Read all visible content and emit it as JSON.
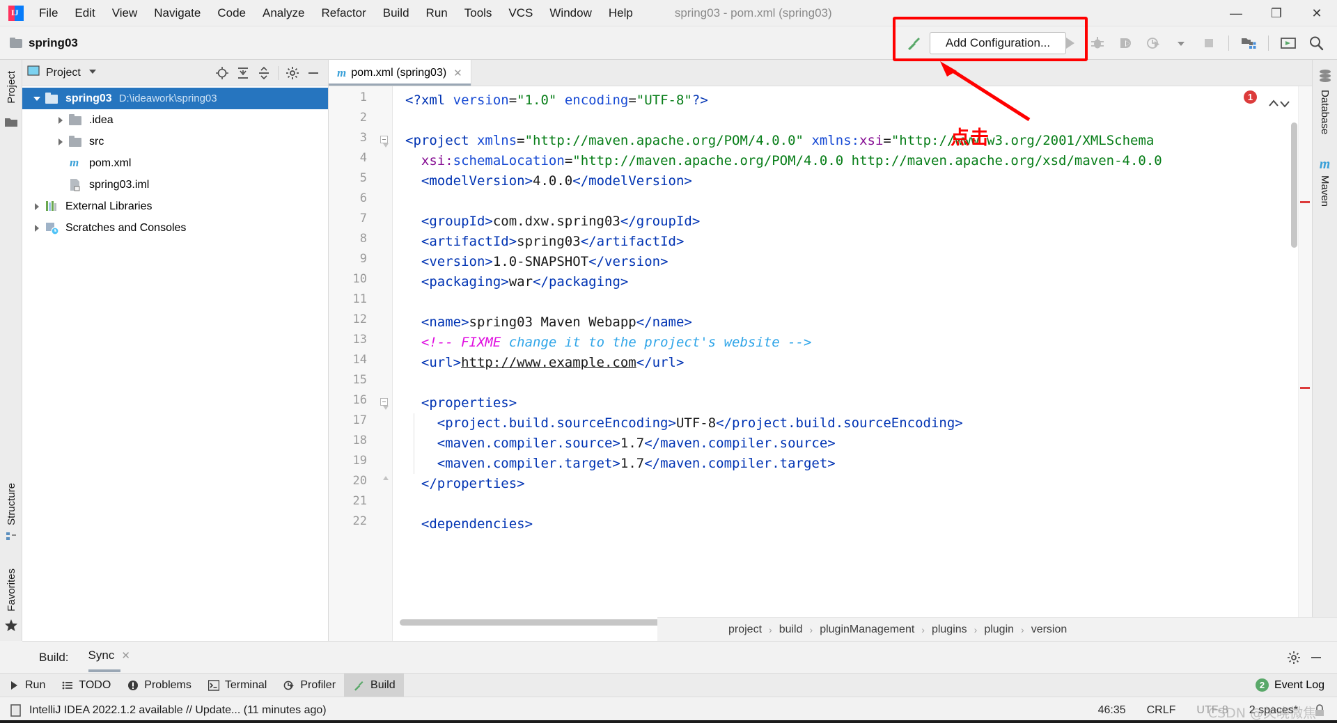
{
  "window": {
    "title": "spring03 - pom.xml (spring03)",
    "minimize": "—",
    "maximize": "❐",
    "close": "✕"
  },
  "menu": [
    {
      "label": "File"
    },
    {
      "label": "Edit"
    },
    {
      "label": "View"
    },
    {
      "label": "Navigate"
    },
    {
      "label": "Code"
    },
    {
      "label": "Analyze"
    },
    {
      "label": "Refactor"
    },
    {
      "label": "Build"
    },
    {
      "label": "Run"
    },
    {
      "label": "Tools"
    },
    {
      "label": "VCS"
    },
    {
      "label": "Window"
    },
    {
      "label": "Help"
    }
  ],
  "toolbar": {
    "project_chip": "spring03",
    "add_configuration": "Add Configuration...",
    "icons": [
      "hammer-icon",
      "run-icon",
      "debug-icon",
      "run-coverage-icon",
      "profile-icon",
      "dropdown-icon",
      "stop-icon",
      "project-structure-icon",
      "search-everywhere-icon",
      "magnifier-icon"
    ]
  },
  "annotation": {
    "text": "点击",
    "color": "#ff0000"
  },
  "left_strip": {
    "top": [
      "Project"
    ],
    "bottom": [
      "Structure",
      "Favorites"
    ]
  },
  "right_strip": [
    "Database",
    "Maven"
  ],
  "project_panel": {
    "header_title": "Project",
    "header_icons": [
      "locate-icon",
      "expand-all-icon",
      "collapse-all-icon",
      "settings-gear-icon",
      "hide-icon"
    ],
    "tree": [
      {
        "label": "spring03",
        "secondary": "D:\\ideawork\\spring03",
        "icon": "module-folder-icon",
        "indent": 0,
        "twisty": "down",
        "selected": true,
        "bold": true
      },
      {
        "label": ".idea",
        "secondary": "",
        "icon": "folder-icon",
        "indent": 1,
        "twisty": "right",
        "selected": false,
        "bold": false
      },
      {
        "label": "src",
        "secondary": "",
        "icon": "folder-icon",
        "indent": 1,
        "twisty": "right",
        "selected": false,
        "bold": false
      },
      {
        "label": "pom.xml",
        "secondary": "",
        "icon": "maven-file-icon",
        "indent": 1,
        "twisty": "none",
        "selected": false,
        "bold": false
      },
      {
        "label": "spring03.iml",
        "secondary": "",
        "icon": "iml-file-icon",
        "indent": 1,
        "twisty": "none",
        "selected": false,
        "bold": false
      },
      {
        "label": "External Libraries",
        "secondary": "",
        "icon": "libraries-icon",
        "indent": 0,
        "twisty": "right",
        "selected": false,
        "bold": false
      },
      {
        "label": "Scratches and Consoles",
        "secondary": "",
        "icon": "scratches-icon",
        "indent": 0,
        "twisty": "right",
        "selected": false,
        "bold": false
      }
    ]
  },
  "editor": {
    "tab": {
      "label": "pom.xml (spring03)",
      "icon": "maven-file-icon",
      "close": "✕"
    },
    "error_count": "1",
    "up_arrow": "∧",
    "down_arrow": "∨",
    "lines": [
      {
        "n": "1",
        "segments": [
          {
            "t": "<?xml ",
            "c": "k-tag"
          },
          {
            "t": "version",
            "c": "k-attr"
          },
          {
            "t": "=",
            "c": "k-txt"
          },
          {
            "t": "\"1.0\"",
            "c": "k-str"
          },
          {
            "t": " ",
            "c": "k-txt"
          },
          {
            "t": "encoding",
            "c": "k-attr"
          },
          {
            "t": "=",
            "c": "k-txt"
          },
          {
            "t": "\"UTF-8\"",
            "c": "k-str"
          },
          {
            "t": "?>",
            "c": "k-tag"
          }
        ],
        "indent": 0
      },
      {
        "n": "2",
        "segments": [],
        "indent": 0
      },
      {
        "n": "3",
        "segments": [
          {
            "t": "<project ",
            "c": "k-tag"
          },
          {
            "t": "xmlns",
            "c": "k-attr"
          },
          {
            "t": "=",
            "c": "k-txt"
          },
          {
            "t": "\"http://maven.apache.org/POM/4.0.0\"",
            "c": "k-str"
          },
          {
            "t": " ",
            "c": "k-txt"
          },
          {
            "t": "xmlns:",
            "c": "k-attr"
          },
          {
            "t": "xsi",
            "c": "k-attr2"
          },
          {
            "t": "=",
            "c": "k-txt"
          },
          {
            "t": "\"http://www.w3.org/2001/XMLSchema",
            "c": "k-str"
          }
        ],
        "indent": 0,
        "fold": "start"
      },
      {
        "n": "4",
        "segments": [
          {
            "t": "  ",
            "c": "k-txt"
          },
          {
            "t": "xsi:",
            "c": "k-attr2"
          },
          {
            "t": "schemaLocation",
            "c": "k-attr"
          },
          {
            "t": "=",
            "c": "k-txt"
          },
          {
            "t": "\"http://maven.apache.org/POM/4.0.0 http://maven.apache.org/xsd/maven-4.0.0",
            "c": "k-str"
          }
        ],
        "indent": 0
      },
      {
        "n": "5",
        "segments": [
          {
            "t": "  ",
            "c": "k-txt"
          },
          {
            "t": "<modelVersion>",
            "c": "k-tag"
          },
          {
            "t": "4.0.0",
            "c": "k-txt"
          },
          {
            "t": "</modelVersion>",
            "c": "k-tag"
          }
        ],
        "indent": 0
      },
      {
        "n": "6",
        "segments": [],
        "indent": 0
      },
      {
        "n": "7",
        "segments": [
          {
            "t": "  ",
            "c": "k-txt"
          },
          {
            "t": "<groupId>",
            "c": "k-tag"
          },
          {
            "t": "com.dxw.spring03",
            "c": "k-txt"
          },
          {
            "t": "</groupId>",
            "c": "k-tag"
          }
        ],
        "indent": 0
      },
      {
        "n": "8",
        "segments": [
          {
            "t": "  ",
            "c": "k-txt"
          },
          {
            "t": "<artifactId>",
            "c": "k-tag"
          },
          {
            "t": "spring03",
            "c": "k-txt"
          },
          {
            "t": "</artifactId>",
            "c": "k-tag"
          }
        ],
        "indent": 0
      },
      {
        "n": "9",
        "segments": [
          {
            "t": "  ",
            "c": "k-txt"
          },
          {
            "t": "<version>",
            "c": "k-tag"
          },
          {
            "t": "1.0-SNAPSHOT",
            "c": "k-txt"
          },
          {
            "t": "</version>",
            "c": "k-tag"
          }
        ],
        "indent": 0
      },
      {
        "n": "10",
        "segments": [
          {
            "t": "  ",
            "c": "k-txt"
          },
          {
            "t": "<packaging>",
            "c": "k-tag"
          },
          {
            "t": "war",
            "c": "k-txt"
          },
          {
            "t": "</packaging>",
            "c": "k-tag"
          }
        ],
        "indent": 0
      },
      {
        "n": "11",
        "segments": [],
        "indent": 0
      },
      {
        "n": "12",
        "segments": [
          {
            "t": "  ",
            "c": "k-txt"
          },
          {
            "t": "<name>",
            "c": "k-tag"
          },
          {
            "t": "spring03 Maven Webapp",
            "c": "k-txt"
          },
          {
            "t": "</name>",
            "c": "k-tag"
          }
        ],
        "indent": 0
      },
      {
        "n": "13",
        "segments": [
          {
            "t": "  ",
            "c": "k-txt"
          },
          {
            "t": "<!-- ",
            "c": "k-cmt-b"
          },
          {
            "t": "FIXME",
            "c": "k-cmt-b"
          },
          {
            "t": " change it to the project's website -->",
            "c": "k-cmt-i"
          }
        ],
        "indent": 0
      },
      {
        "n": "14",
        "segments": [
          {
            "t": "  ",
            "c": "k-txt"
          },
          {
            "t": "<url>",
            "c": "k-tag"
          },
          {
            "t": "http://www.example.com",
            "c": "k-link"
          },
          {
            "t": "</url>",
            "c": "k-tag"
          }
        ],
        "indent": 0
      },
      {
        "n": "15",
        "segments": [],
        "indent": 0
      },
      {
        "n": "16",
        "segments": [
          {
            "t": "  ",
            "c": "k-txt"
          },
          {
            "t": "<properties>",
            "c": "k-tag"
          }
        ],
        "indent": 0,
        "fold": "start"
      },
      {
        "n": "17",
        "segments": [
          {
            "t": "    ",
            "c": "k-txt"
          },
          {
            "t": "<project.build.sourceEncoding>",
            "c": "k-tag"
          },
          {
            "t": "UTF-8",
            "c": "k-txt"
          },
          {
            "t": "</project.build.sourceEncoding>",
            "c": "k-tag"
          }
        ],
        "indent": 1
      },
      {
        "n": "18",
        "segments": [
          {
            "t": "    ",
            "c": "k-txt"
          },
          {
            "t": "<maven.compiler.source>",
            "c": "k-tag"
          },
          {
            "t": "1.7",
            "c": "k-txt"
          },
          {
            "t": "</maven.compiler.source>",
            "c": "k-tag"
          }
        ],
        "indent": 1
      },
      {
        "n": "19",
        "segments": [
          {
            "t": "    ",
            "c": "k-txt"
          },
          {
            "t": "<maven.compiler.target>",
            "c": "k-tag"
          },
          {
            "t": "1.7",
            "c": "k-txt"
          },
          {
            "t": "</maven.compiler.target>",
            "c": "k-tag"
          }
        ],
        "indent": 1
      },
      {
        "n": "20",
        "segments": [
          {
            "t": "  ",
            "c": "k-txt"
          },
          {
            "t": "</properties>",
            "c": "k-tag"
          }
        ],
        "indent": 0,
        "fold": "end"
      },
      {
        "n": "21",
        "segments": [],
        "indent": 0
      },
      {
        "n": "22",
        "segments": [
          {
            "t": "  ",
            "c": "k-txt"
          },
          {
            "t": "<dependencies>",
            "c": "k-tag"
          }
        ],
        "indent": 0
      }
    ],
    "breadcrumb": [
      "project",
      "build",
      "pluginManagement",
      "plugins",
      "plugin",
      "version"
    ],
    "breadcrumb_separator": "›"
  },
  "build_tool_window": {
    "label": "Build:",
    "tab": "Sync",
    "tab_close": "✕",
    "icons": [
      "settings-gear-icon",
      "hide-icon"
    ]
  },
  "bottom_bar": {
    "items": [
      {
        "label": "Run",
        "icon": "run-icon",
        "active": false
      },
      {
        "label": "TODO",
        "icon": "todo-icon",
        "active": false
      },
      {
        "label": "Problems",
        "icon": "problems-icon",
        "active": false
      },
      {
        "label": "Terminal",
        "icon": "terminal-icon",
        "active": false
      },
      {
        "label": "Profiler",
        "icon": "profiler-icon",
        "active": false
      },
      {
        "label": "Build",
        "icon": "hammer-icon",
        "active": true
      }
    ],
    "event_log": {
      "count": "2",
      "label": "Event Log"
    }
  },
  "status_bar": {
    "message": "IntelliJ IDEA 2022.1.2 available // Update... (11 minutes ago)",
    "caret": "46:35",
    "line_separator": "CRLF",
    "encoding": "UTF-8",
    "indent": "2 spaces*",
    "lock_icon": "lock-icon",
    "watermark": "CSDN @关晓微焦"
  }
}
